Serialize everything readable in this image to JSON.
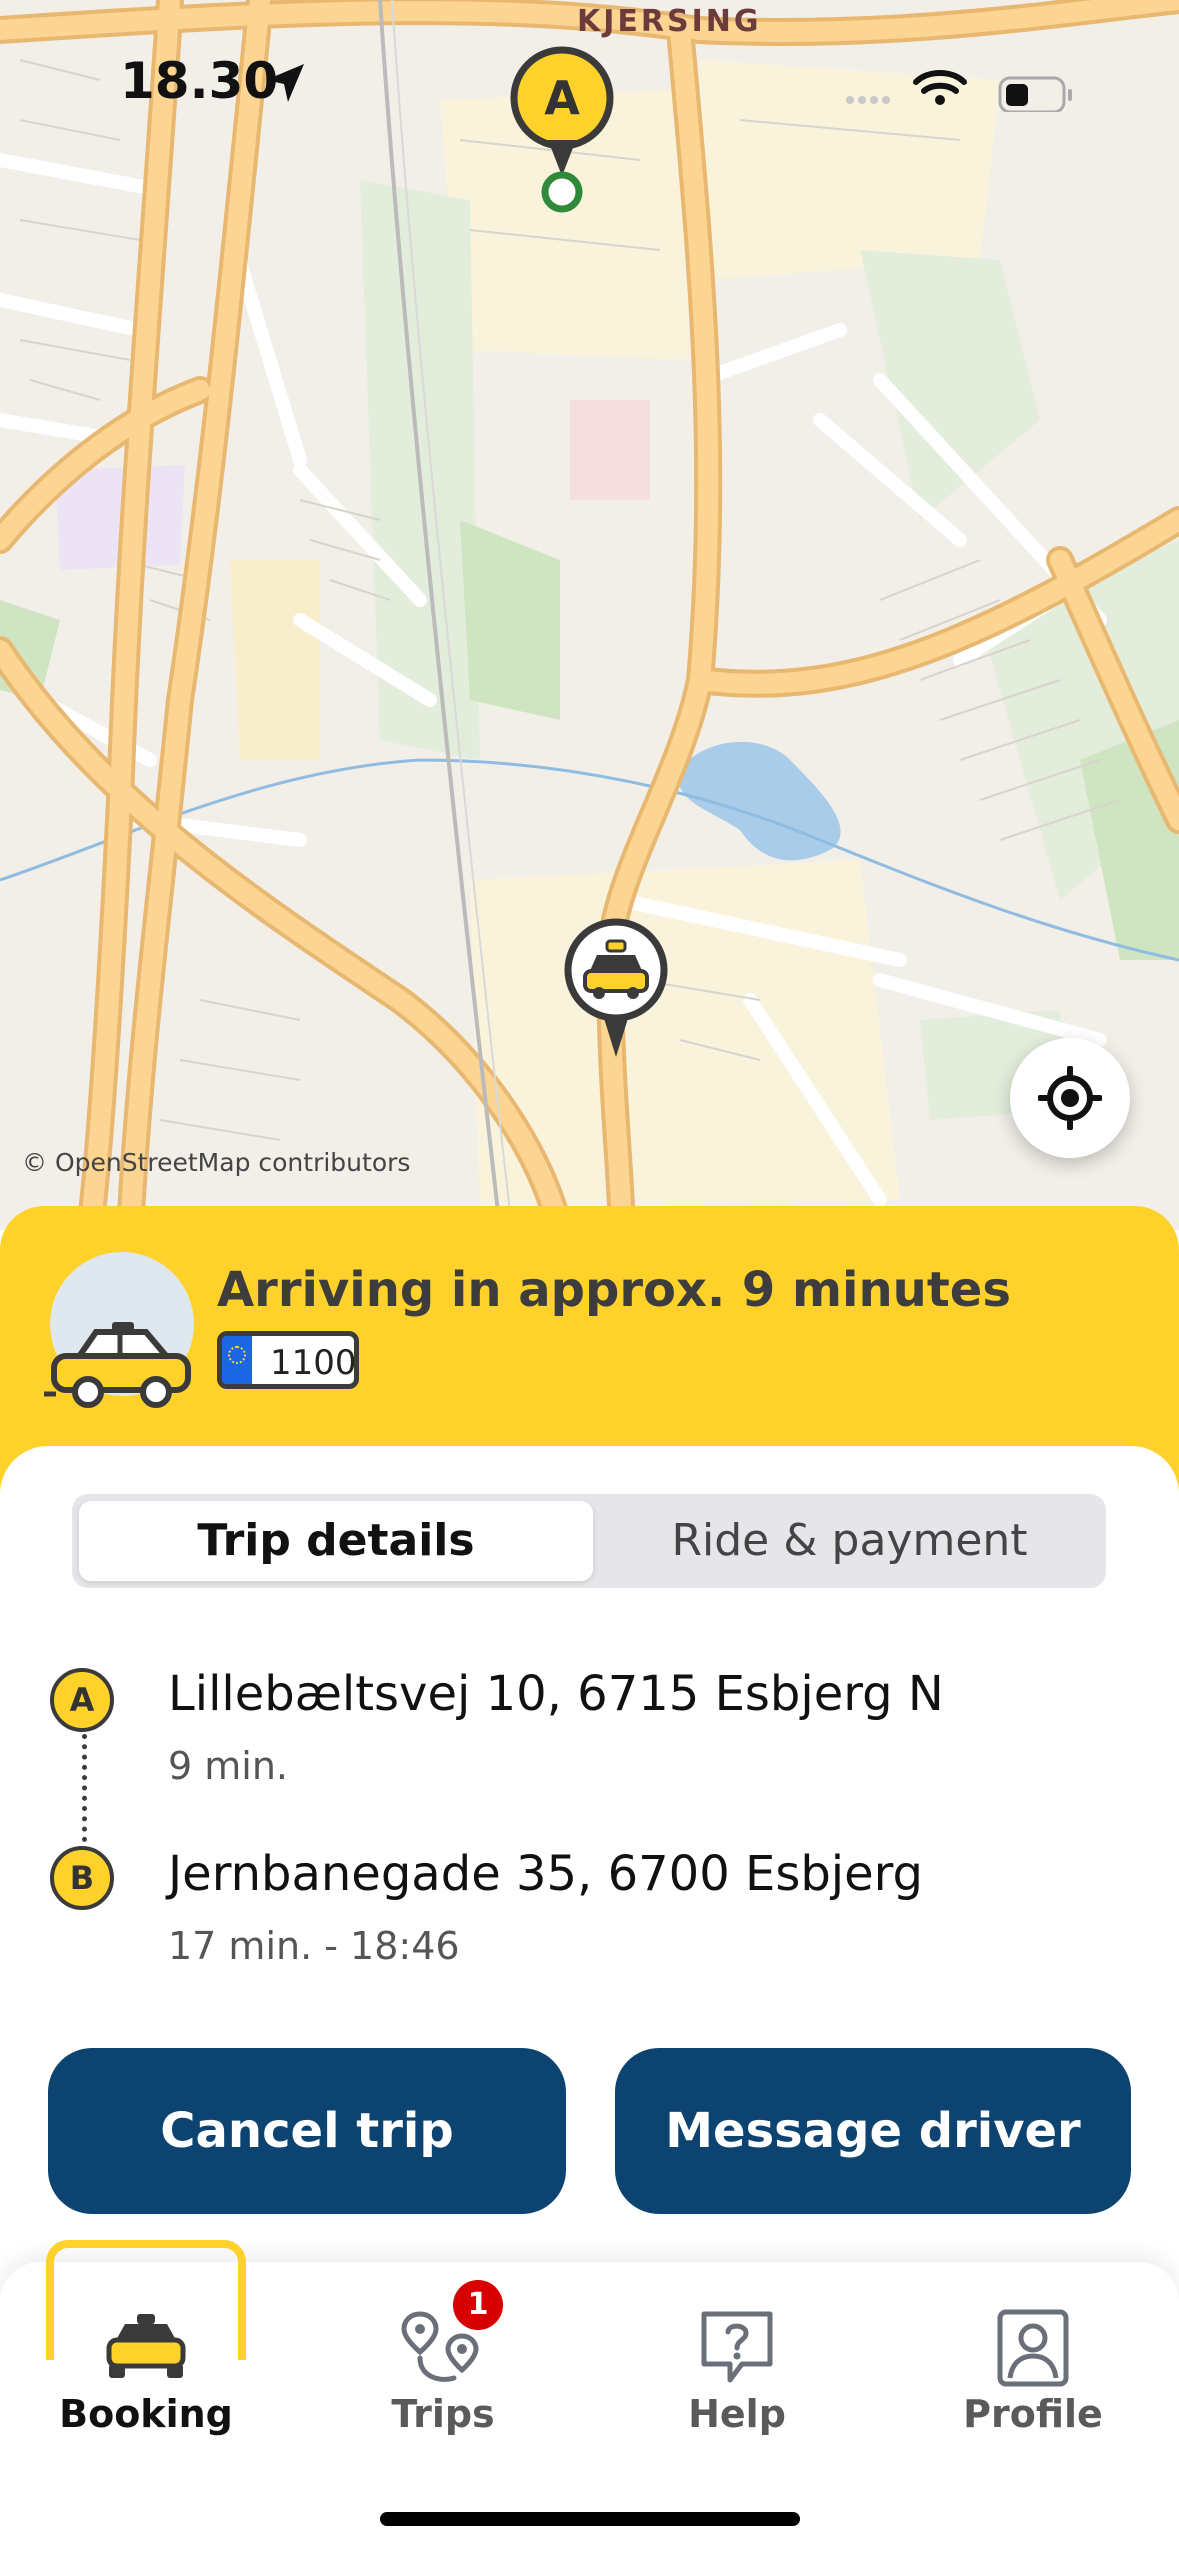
{
  "status_bar": {
    "time": "18.30"
  },
  "map": {
    "area_label": "KJERSING",
    "pin_a_label": "A",
    "attribution": "© OpenStreetMap contributors"
  },
  "arrival": {
    "text": "Arriving in approx. 9 minutes",
    "plate": "1100"
  },
  "tabs": {
    "trip_details": "Trip details",
    "ride_payment": "Ride & payment",
    "active": "trip_details"
  },
  "route": {
    "stops": [
      {
        "marker": "A",
        "address": "Lillebæltsvej 10, 6715 Esbjerg N",
        "detail": "9 min."
      },
      {
        "marker": "B",
        "address": "Jernbanegade 35, 6700 Esbjerg",
        "detail": "17 min. - 18:46"
      }
    ]
  },
  "actions": {
    "cancel": "Cancel trip",
    "message": "Message driver"
  },
  "bottom_nav": {
    "items": [
      {
        "label": "Booking",
        "icon": "taxi-icon",
        "active": true
      },
      {
        "label": "Trips",
        "icon": "route-icon",
        "badge": "1"
      },
      {
        "label": "Help",
        "icon": "help-icon"
      },
      {
        "label": "Profile",
        "icon": "profile-icon"
      }
    ]
  },
  "colors": {
    "brand_yellow": "#FFD22B",
    "brand_navy": "#0C4370",
    "badge_red": "#D60000"
  }
}
